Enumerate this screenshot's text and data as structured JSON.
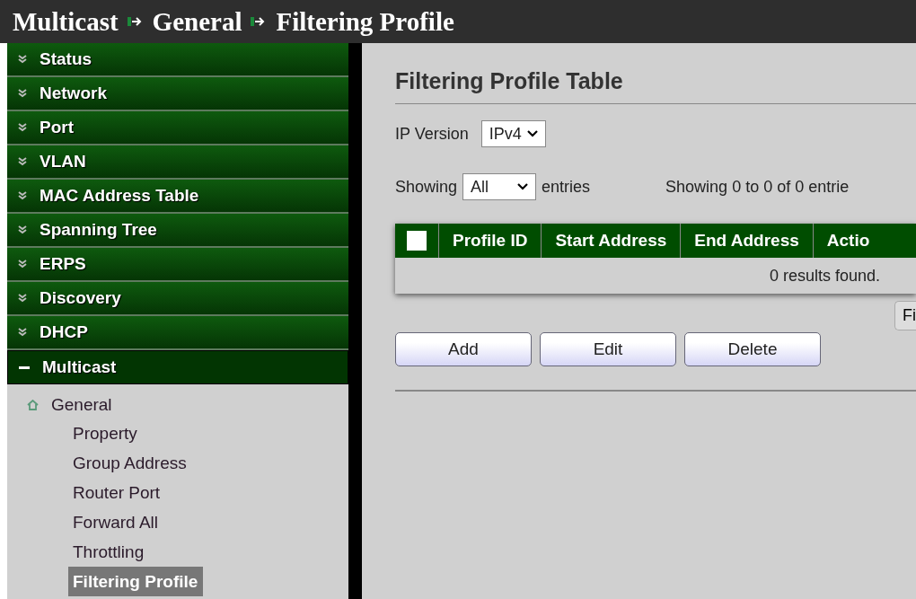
{
  "breadcrumb": [
    "Multicast",
    "General",
    "Filtering Profile"
  ],
  "sidebar": {
    "items": [
      {
        "label": "Status",
        "expanded": false
      },
      {
        "label": "Network",
        "expanded": false
      },
      {
        "label": "Port",
        "expanded": false
      },
      {
        "label": "VLAN",
        "expanded": false
      },
      {
        "label": "MAC Address Table",
        "expanded": false
      },
      {
        "label": "Spanning Tree",
        "expanded": false
      },
      {
        "label": "ERPS",
        "expanded": false
      },
      {
        "label": "Discovery",
        "expanded": false
      },
      {
        "label": "DHCP",
        "expanded": false
      },
      {
        "label": "Multicast",
        "expanded": true,
        "children": [
          {
            "label": "General",
            "children": [
              {
                "label": "Property",
                "selected": false
              },
              {
                "label": "Group Address",
                "selected": false
              },
              {
                "label": "Router Port",
                "selected": false
              },
              {
                "label": "Forward All",
                "selected": false
              },
              {
                "label": "Throttling",
                "selected": false
              },
              {
                "label": "Filtering Profile",
                "selected": true
              }
            ]
          }
        ]
      }
    ]
  },
  "content": {
    "title": "Filtering Profile Table",
    "ip_version": {
      "label": "IP Version",
      "value": "IPv4"
    },
    "showing": {
      "label": "Showing",
      "value": "All",
      "suffix": "entries",
      "info": "Showing 0 to 0 of 0 entrie"
    },
    "table": {
      "select_all": {
        "checked": false
      },
      "columns": [
        "Profile ID",
        "Start Address",
        "End Address",
        "Actio"
      ],
      "empty_message": "0 results found."
    },
    "cut_button": "Fi",
    "buttons": [
      "Add",
      "Edit",
      "Delete"
    ]
  }
}
